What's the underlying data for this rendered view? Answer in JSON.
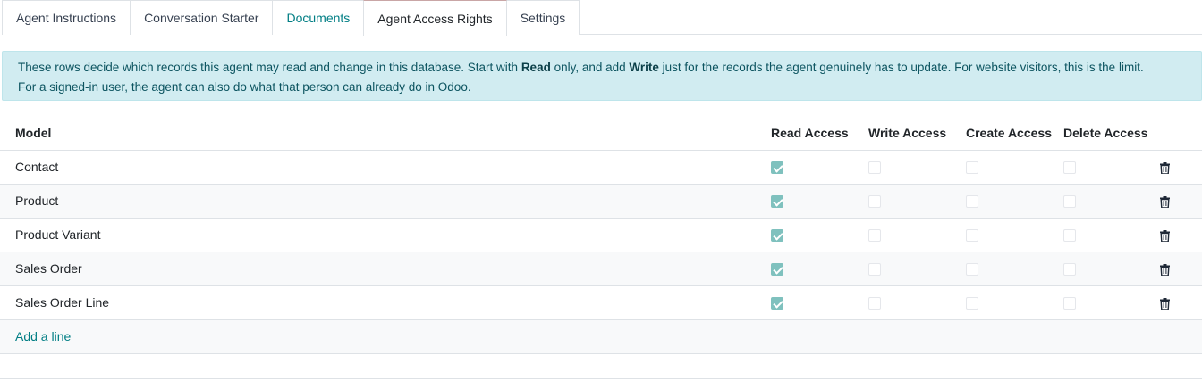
{
  "tabs": [
    {
      "label": "Agent Instructions"
    },
    {
      "label": "Conversation Starter"
    },
    {
      "label": "Documents"
    },
    {
      "label": "Agent Access Rights"
    },
    {
      "label": "Settings"
    }
  ],
  "active_tab": "Agent Access Rights",
  "alert": {
    "part1": "These rows decide which records this agent may read and change in this database. Start with ",
    "bold1": "Read",
    "part2": " only, and add ",
    "bold2": "Write",
    "part3": " just for the records the agent genuinely has to update. For website visitors, this is the limit.",
    "line2": "For a signed-in user, the agent can also do what that person can already do in Odoo."
  },
  "table": {
    "headers": {
      "model": "Model",
      "read": "Read Access",
      "write": "Write Access",
      "create": "Create Access",
      "delete": "Delete Access"
    },
    "rows": [
      {
        "model": "Contact",
        "read": true,
        "write": false,
        "create": false,
        "delete": false
      },
      {
        "model": "Product",
        "read": true,
        "write": false,
        "create": false,
        "delete": false
      },
      {
        "model": "Product Variant",
        "read": true,
        "write": false,
        "create": false,
        "delete": false
      },
      {
        "model": "Sales Order",
        "read": true,
        "write": false,
        "create": false,
        "delete": false
      },
      {
        "model": "Sales Order Line",
        "read": true,
        "write": false,
        "create": false,
        "delete": false
      }
    ],
    "add_line": "Add a line"
  },
  "colors": {
    "accent": "#017e84",
    "alert_bg": "#d1ecf1",
    "checkbox_on": "#7fc1be"
  },
  "icons": {
    "delete_row": "trash-icon",
    "checkbox": "checkbox"
  }
}
